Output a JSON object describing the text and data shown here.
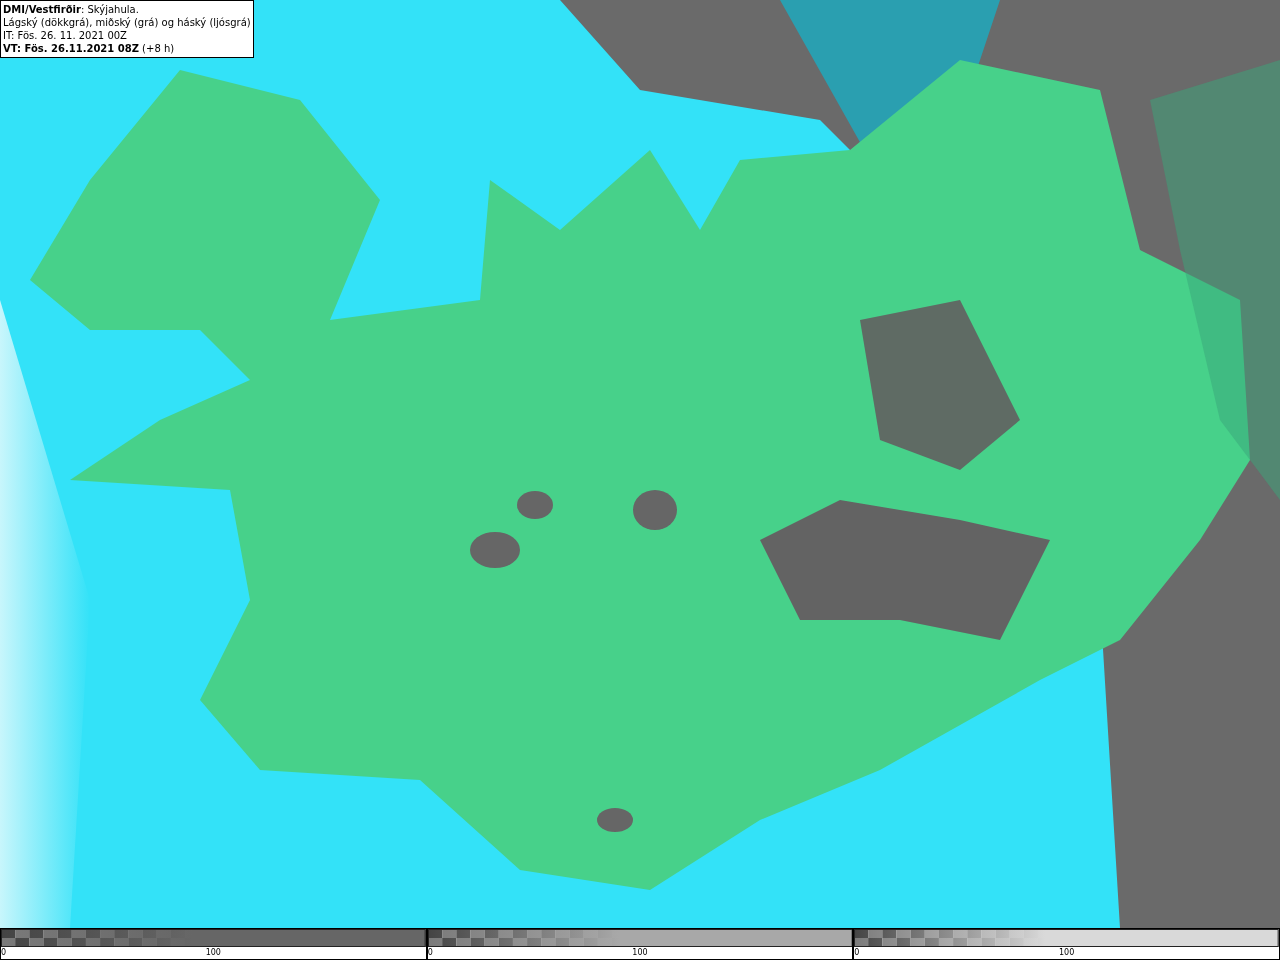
{
  "info_box": {
    "lines": [
      "**DMI/Vestfirðir**: Skýjahula.",
      "Lágský (dökkgrá), miðský (grá) og háský (ljósgrá)",
      "IT: Fös. 26. 11. 2021 00Z",
      "**VT: Fös. 26.11.2021 08Z** (+8 h)"
    ]
  },
  "legends": [
    {
      "color": "#666666",
      "ticks": [
        "0",
        "100"
      ]
    },
    {
      "color": "#a8a8a8",
      "ticks": [
        "0",
        "100"
      ]
    },
    {
      "color": "#d9d9d9",
      "ticks": [
        "0",
        "100"
      ]
    }
  ]
}
